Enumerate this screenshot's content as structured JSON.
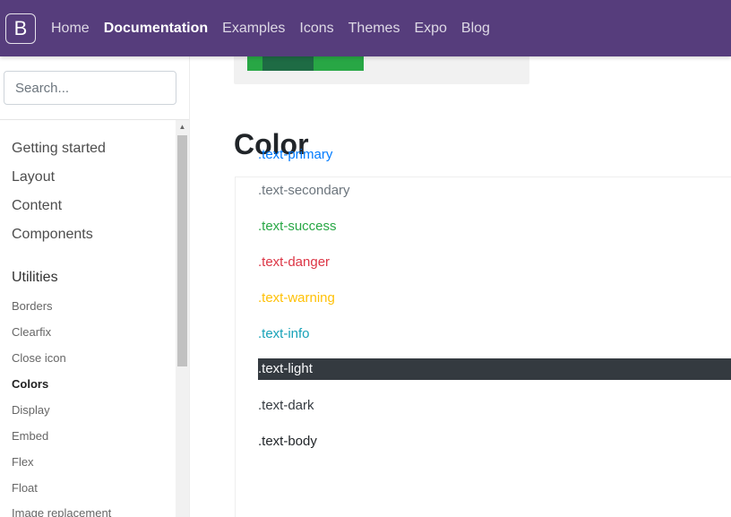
{
  "navbar": {
    "brand": "B",
    "links": [
      "Home",
      "Documentation",
      "Examples",
      "Icons",
      "Themes",
      "Expo",
      "Blog"
    ],
    "active": "Documentation",
    "background": "#563d7c"
  },
  "sidebar": {
    "search_placeholder": "Search...",
    "sections": [
      "Getting started",
      "Layout",
      "Content",
      "Components",
      "Utilities"
    ],
    "utility_items": [
      "Borders",
      "Clearfix",
      "Close icon",
      "Colors",
      "Display",
      "Embed",
      "Flex",
      "Float",
      "Image replacement"
    ],
    "active_item": "Colors"
  },
  "main": {
    "heading": "Color",
    "color_classes": [
      {
        "label": ".text-primary",
        "color": "#007bff"
      },
      {
        "label": ".text-secondary",
        "color": "#6c757d"
      },
      {
        "label": ".text-success",
        "color": "#28a745"
      },
      {
        "label": ".text-danger",
        "color": "#dc3545"
      },
      {
        "label": ".text-warning",
        "color": "#ffc107"
      },
      {
        "label": ".text-info",
        "color": "#17a2b8"
      },
      {
        "label": ".text-light",
        "color": "#f8f9fa",
        "background": "#343a40"
      },
      {
        "label": ".text-dark",
        "color": "#343a40"
      },
      {
        "label": ".text-body",
        "color": "#212529"
      }
    ]
  }
}
